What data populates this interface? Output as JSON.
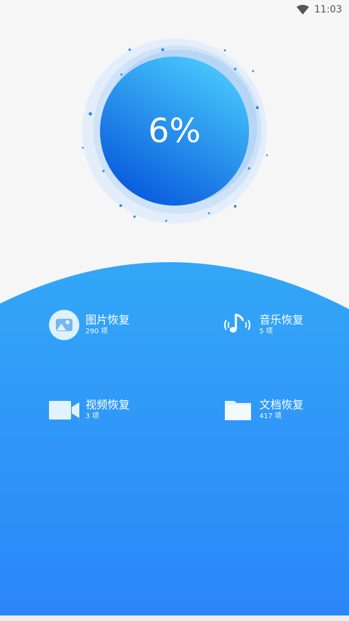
{
  "status": {
    "time": "11:03"
  },
  "progress": {
    "percent_text": "6%",
    "value": 0.06
  },
  "categories": [
    {
      "label": "图片恢复",
      "count": "290 项",
      "icon": "image-icon"
    },
    {
      "label": "音乐恢复",
      "count": "5 项",
      "icon": "music-icon"
    },
    {
      "label": "视频恢复",
      "count": "3 项",
      "icon": "video-icon"
    },
    {
      "label": "文档恢复",
      "count": "417 项",
      "icon": "folder-icon"
    }
  ],
  "colors": {
    "panel_top": "#33a7f7",
    "panel_bottom": "#2a86f8",
    "circle_light": "#49c6fb",
    "circle_dark": "#0a5fdc"
  }
}
